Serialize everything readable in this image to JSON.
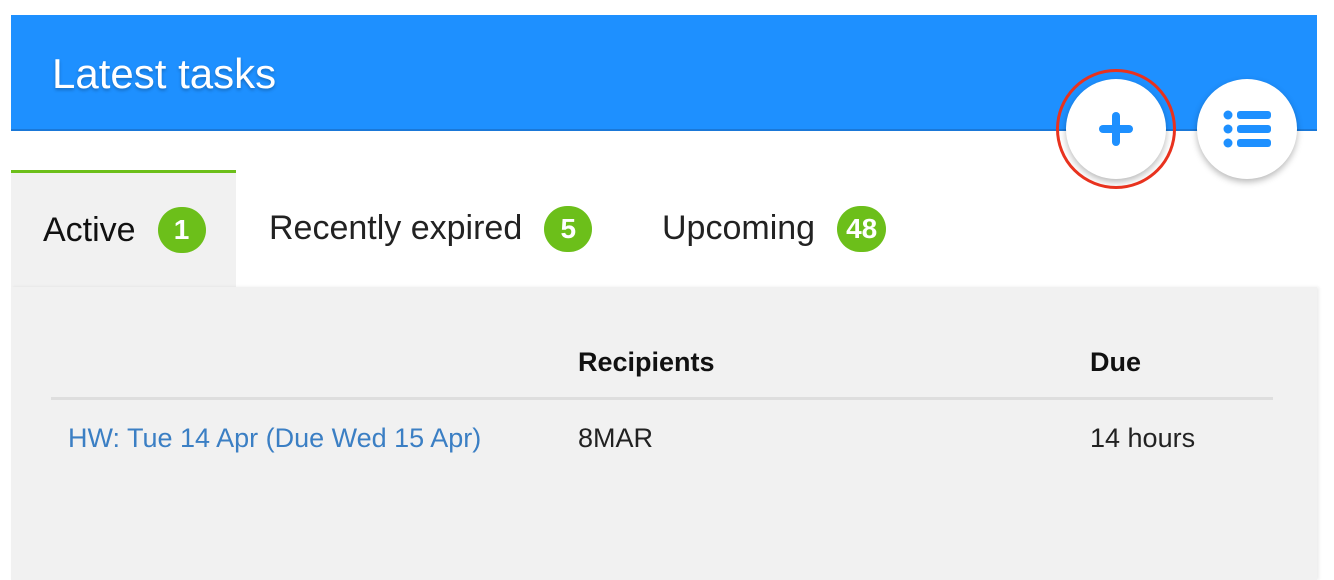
{
  "header": {
    "title": "Latest tasks"
  },
  "actions": {
    "add_icon": "plus-icon",
    "list_icon": "list-icon"
  },
  "tabs": [
    {
      "label": "Active",
      "count": "1",
      "active": true
    },
    {
      "label": "Recently expired",
      "count": "5",
      "active": false
    },
    {
      "label": "Upcoming",
      "count": "48",
      "active": false
    }
  ],
  "table": {
    "headers": {
      "title": "",
      "recipients": "Recipients",
      "due": "Due"
    },
    "rows": [
      {
        "title": "HW: Tue 14 Apr (Due Wed 15 Apr)",
        "recipients": "8MAR",
        "due": "14 hours"
      }
    ]
  },
  "colors": {
    "header_bg": "#1e90ff",
    "badge_bg": "#6cbf1a",
    "link": "#3b7fc4",
    "highlight_ring": "#e8321e"
  }
}
